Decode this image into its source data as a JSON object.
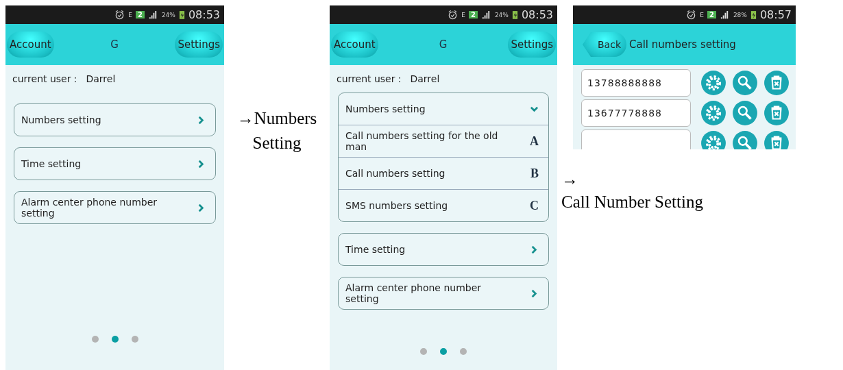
{
  "screens": [
    {
      "kind": "main",
      "status_bar": {
        "network": "E",
        "sim": "2",
        "battery": "24%",
        "time": "08:53"
      },
      "header": {
        "kind": "main",
        "left_button": "Account",
        "title": "G",
        "right_button": "Settings"
      },
      "current_user": {
        "label": "current user：",
        "name": "Darrel"
      },
      "menu": [
        {
          "label": "Numbers setting",
          "expanded": false
        },
        {
          "label": "Time setting",
          "expanded": false
        },
        {
          "label": "Alarm center phone number setting",
          "expanded": false
        }
      ],
      "page_dots": [
        {
          "selected": false
        },
        {
          "selected": true
        },
        {
          "selected": false
        }
      ]
    },
    {
      "kind": "main",
      "status_bar": {
        "network": "E",
        "sim": "2",
        "battery": "24%",
        "time": "08:53"
      },
      "header": {
        "kind": "main",
        "left_button": "Account",
        "title": "G",
        "right_button": "Settings"
      },
      "current_user": {
        "label": "current user：",
        "name": "Darrel"
      },
      "menu": [
        {
          "label": "Numbers setting",
          "expanded": true,
          "children": [
            {
              "label": "Call numbers setting for the old man",
              "marker": "A"
            },
            {
              "label": "Call numbers setting",
              "marker": "B"
            },
            {
              "label": "SMS numbers setting",
              "marker": "C"
            }
          ]
        },
        {
          "label": "Time setting",
          "expanded": false
        },
        {
          "label": "Alarm center phone number setting",
          "expanded": false
        }
      ],
      "page_dots": [
        {
          "selected": false
        },
        {
          "selected": true
        },
        {
          "selected": false
        }
      ]
    },
    {
      "kind": "numbers",
      "status_bar": {
        "network": "E",
        "sim": "2",
        "battery": "28%",
        "time": "08:57"
      },
      "header": {
        "kind": "back",
        "back_button": "Back",
        "title": "Call numbers setting"
      },
      "number_rows": [
        {
          "kind": "filled",
          "value": "13788888888"
        },
        {
          "kind": "filled",
          "value": "13677778888"
        },
        {
          "kind": "blank"
        }
      ]
    }
  ],
  "annotations": [
    {
      "arrow": "→",
      "text": "Numbers Setting"
    },
    {
      "arrow": "→",
      "text": "Call Number Setting"
    }
  ]
}
